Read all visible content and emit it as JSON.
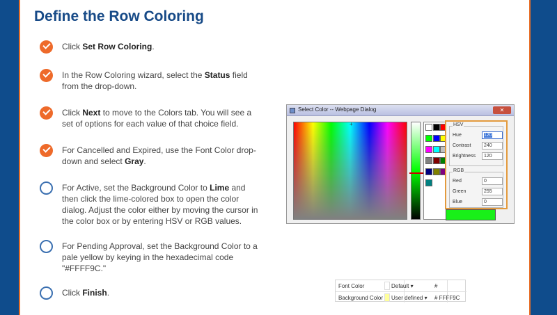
{
  "title": "Define the Row Coloring",
  "steps": [
    {
      "done": true,
      "parts": [
        {
          "t": "Click "
        },
        {
          "t": "Set Row Coloring",
          "b": true
        },
        {
          "t": "."
        }
      ]
    },
    {
      "done": true,
      "parts": [
        {
          "t": "In the Row Coloring wizard, select the "
        },
        {
          "t": "Status",
          "b": true
        },
        {
          "t": " field from the drop-down."
        }
      ]
    },
    {
      "done": true,
      "parts": [
        {
          "t": "Click "
        },
        {
          "t": "Next",
          "b": true
        },
        {
          "t": " to move to the Colors tab. You will see a set of options for each value of that choice field."
        }
      ]
    },
    {
      "done": true,
      "parts": [
        {
          "t": "For Cancelled and Expired, use the Font Color drop-down and select "
        },
        {
          "t": "Gray",
          "b": true
        },
        {
          "t": "."
        }
      ]
    },
    {
      "done": false,
      "parts": [
        {
          "t": "For Active, set the Background Color to "
        },
        {
          "t": "Lime",
          "b": true
        },
        {
          "t": " and then click the lime-colored box to open the color dialog. Adjust the color either by moving the cursor in the color box or by entering HSV or RGB values."
        }
      ]
    },
    {
      "done": false,
      "parts": [
        {
          "t": "For Pending Approval, set the Background Color to a pale yellow by keying in the hexadecimal code \"#FFFF9C.\""
        }
      ]
    },
    {
      "done": false,
      "parts": [
        {
          "t": "Click "
        },
        {
          "t": "Finish",
          "b": true
        },
        {
          "t": "."
        }
      ]
    }
  ],
  "dialog": {
    "title": "Select Color -- Webpage Dialog",
    "hsv_label": "HSV",
    "hue_label": "Hue",
    "hue": "120",
    "contrast_label": "Contrast",
    "contrast": "240",
    "brightness_label": "Brightness",
    "brightness": "120",
    "rgb_label": "RGB",
    "red_label": "Red",
    "red": "0",
    "green_label": "Green",
    "green": "255",
    "blue_label": "Blue",
    "blue": "0",
    "preview_color": "#19f019",
    "swatches": [
      "#ffffff",
      "#000000",
      "#ff0000",
      "#00ff00",
      "#0000ff",
      "#ffff00",
      "#ff00ff",
      "#00ffff",
      "#c0c0c0",
      "#808080",
      "#800000",
      "#008000",
      "#000080",
      "#808000",
      "#800080",
      "#008080"
    ]
  },
  "color_table": {
    "rows": [
      {
        "label": "Font Color",
        "swatch": "#ffffff",
        "select": "Default",
        "hex": "#"
      },
      {
        "label": "Background Color",
        "swatch": "#ffff9c",
        "select": "User defined",
        "hex": "# FFFF9C"
      }
    ]
  },
  "colors": {
    "accent": "#ee6a2a",
    "title": "#174a87",
    "frame": "#0f4c8c"
  }
}
